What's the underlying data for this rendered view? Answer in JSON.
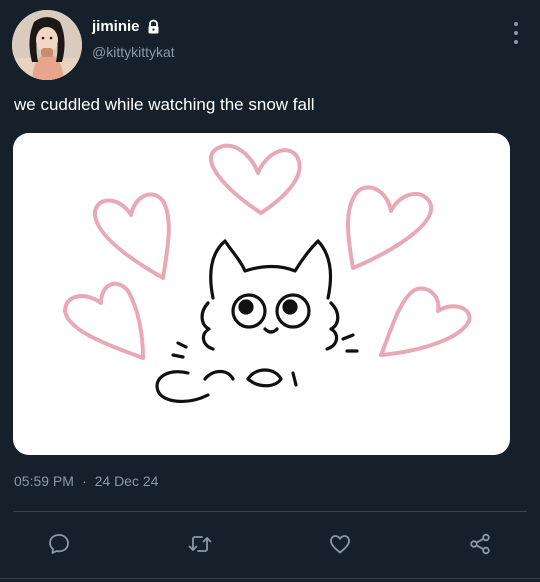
{
  "author": {
    "display_name": "jiminie",
    "handle": "@kittykittykat",
    "avatar_icon": "profile-photo",
    "protected_icon": "lock-icon"
  },
  "tweet": {
    "text": "we cuddled while watching the snow fall",
    "media_description_icon": "cat-drawing-with-hearts"
  },
  "meta": {
    "time": "05:59 PM",
    "separator": "·",
    "date": "24 Dec 24"
  },
  "actions": [
    {
      "name": "reply",
      "icon": "speech-bubble-icon"
    },
    {
      "name": "retweet",
      "icon": "retweet-icon"
    },
    {
      "name": "like",
      "icon": "heart-icon"
    },
    {
      "name": "share",
      "icon": "share-icon"
    }
  ],
  "colors": {
    "background": "#15202b",
    "secondary_text": "#8b98a5",
    "divider": "#38444d",
    "heart_pink": "#e8a9b4"
  }
}
